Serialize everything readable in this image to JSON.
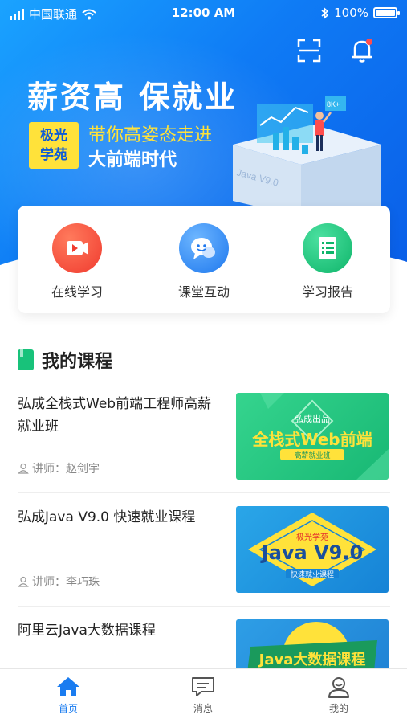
{
  "status": {
    "carrier": "中国联通",
    "time": "12:00 AM",
    "battery": "100%"
  },
  "banner": {
    "slogan": "薪资高 保就业",
    "badge_line1": "极光",
    "badge_line2": "学苑",
    "sub1": "带你高姿态走进",
    "sub2": "大前端时代",
    "art_label": "Java V9.0",
    "art_tag": "8K+"
  },
  "features": [
    {
      "label": "在线学习",
      "icon": "video-icon",
      "color": "#f4493a"
    },
    {
      "label": "课堂互动",
      "icon": "chat-icon",
      "color": "#2f8cf5"
    },
    {
      "label": "学习报告",
      "icon": "report-icon",
      "color": "#15c27a"
    }
  ],
  "section": {
    "title": "我的课程"
  },
  "courses": [
    {
      "title": "弘成全栈式Web前端工程师高薪就业班",
      "teacher": "讲师：赵剑宇",
      "thumb": {
        "top": "弘成出品",
        "main": "全栈式Web前端",
        "bottom": "高薪就业班"
      }
    },
    {
      "title": "弘成Java V9.0 快速就业课程",
      "teacher": "讲师：李巧珠",
      "thumb": {
        "top": "极光学苑",
        "main": "Java V9.0",
        "bottom": "快速就业课程"
      }
    },
    {
      "title": "阿里云Java大数据课程",
      "teacher": "",
      "thumb": {
        "main": "Java大数据课程"
      }
    }
  ],
  "tabs": [
    {
      "label": "首页",
      "icon": "home-icon",
      "active": true
    },
    {
      "label": "消息",
      "icon": "message-icon",
      "active": false
    },
    {
      "label": "我的",
      "icon": "profile-icon",
      "active": false
    }
  ],
  "colors": {
    "primary": "#1a7cf0",
    "accent_yellow": "#ffe23a",
    "green": "#18c27a"
  }
}
